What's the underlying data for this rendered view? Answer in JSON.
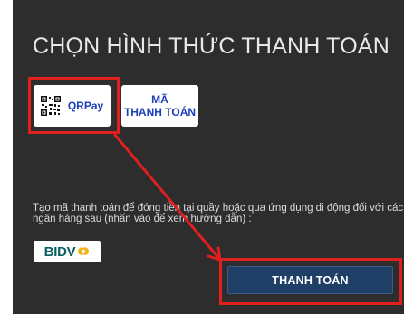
{
  "dialog": {
    "title": "CHỌN HÌNH THỨC THANH TOÁN",
    "options": [
      {
        "icon": "qr-code-icon",
        "label": "QRPay"
      },
      {
        "line1": "MÃ",
        "line2": "THANH TOÁN"
      }
    ],
    "info_text": "Tạo mã thanh toán để đóng tiền tại quầy hoặc qua ứng dụng di động đối với các ngân hàng sau (nhấn vào để xem hướng dẫn) :",
    "bank": {
      "name": "BIDV",
      "icon": "bidv-logo-mark-icon"
    },
    "pay_button": "THANH TOÁN"
  },
  "colors": {
    "panel_bg": "#2d2d2d",
    "accent_blue": "#1d3fb8",
    "button_bg": "#1f3f67",
    "annotation_red": "#e0201f",
    "bidv_teal": "#0a5f62",
    "bidv_gold": "#f3b319"
  }
}
